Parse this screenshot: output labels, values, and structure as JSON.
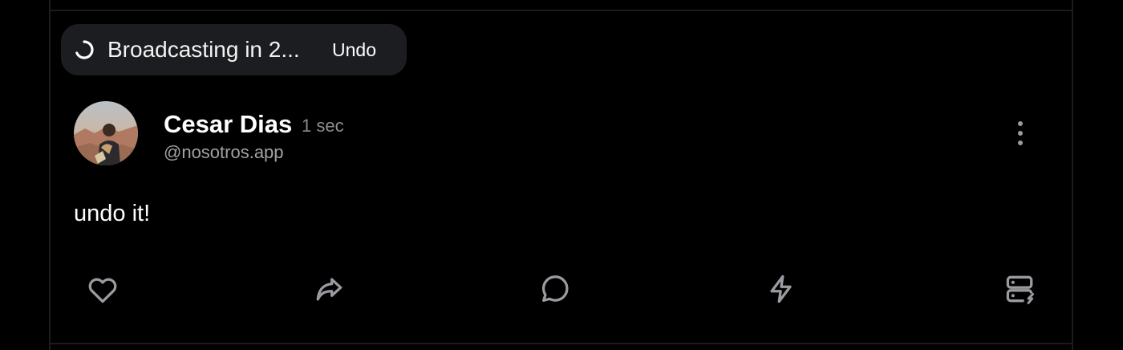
{
  "toast": {
    "status_text": "Broadcasting in 2...",
    "undo_label": "Undo"
  },
  "post": {
    "author_name": "Cesar Dias",
    "time_ago": "1 sec",
    "author_handle": "@nosotros.app",
    "content": "undo it!"
  },
  "actions": {
    "icons": [
      "heart-icon",
      "repost-icon",
      "reply-icon",
      "zap-icon",
      "relays-icon"
    ]
  },
  "colors": {
    "background": "#000000",
    "toast_background": "#1c1d20",
    "muted_text": "#8e8e93",
    "icon": "#9a9aa0",
    "border": "#1c1c1e"
  }
}
